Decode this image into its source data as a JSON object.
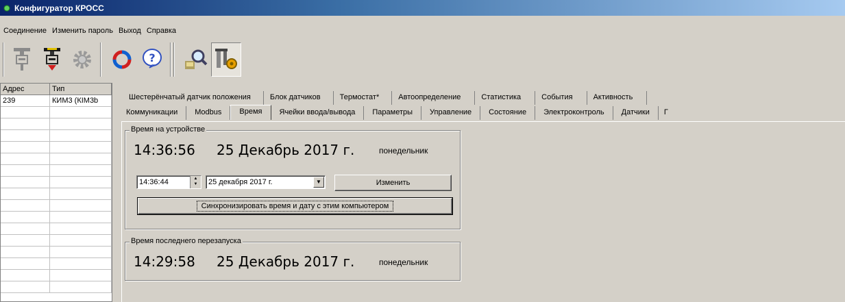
{
  "window": {
    "title": "Конфигуратор КРОСС"
  },
  "menu": [
    "Соединение",
    "Изменить пароль",
    "Выход",
    "Справка"
  ],
  "toolbar": {
    "icons": [
      "connect-plug-icon",
      "disconnect-plug-icon",
      "settings-gear-icon",
      "refresh-icon",
      "help-icon",
      "search-device-icon",
      "device-config-icon"
    ]
  },
  "grid": {
    "headers": [
      "Адрес",
      "Тип"
    ],
    "rows": [
      {
        "address": "239",
        "type": "КИМ3 (КIM3b"
      }
    ]
  },
  "tabs": {
    "row1": [
      "Шестерёнчатый датчик положения",
      "Блок датчиков",
      "Термостат*",
      "Автоопределение",
      "Статистика",
      "События",
      "Активность",
      ""
    ],
    "row2": [
      "Коммуникации",
      "Modbus",
      "Время",
      "Ячейки ввода/вывода",
      "Параметры",
      "Управление",
      "Состояние",
      "Электроконтроль",
      "Датчики",
      "Г"
    ],
    "active": "Время"
  },
  "device_time": {
    "title": "Время на устройстве",
    "time": "14:36:56",
    "date": "25 Декабрь 2017 г.",
    "weekday": "понедельник",
    "time_input": "14:36:44",
    "date_input": "25 декабря  2017 г.",
    "change_button": "Изменить",
    "sync_button": "Синхронизировать время и дату с этим компьютером"
  },
  "last_restart": {
    "title": "Время последнего перезапуска",
    "time": "14:29:58",
    "date": "25 Декабрь 2017 г.",
    "weekday": "понедельник"
  }
}
